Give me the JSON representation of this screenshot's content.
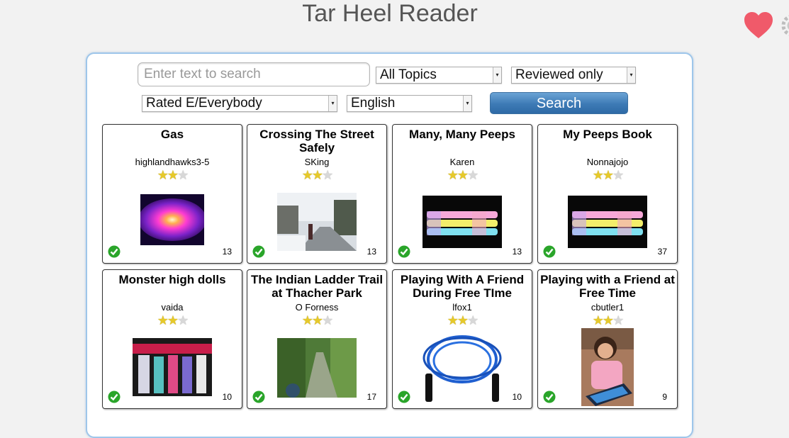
{
  "header": {
    "title": "Tar Heel Reader",
    "favorites_icon": "heart-icon",
    "settings_icon": "gear-icon"
  },
  "search": {
    "placeholder": "Enter text to search",
    "topic": "All Topics",
    "review": "Reviewed only",
    "rating": "Rated E/Everybody",
    "language": "English",
    "button_label": "Search"
  },
  "colors": {
    "heart": "#f05a6a",
    "button": "#3d7ab5",
    "check": "#2aa52a",
    "star": "#e6c92a"
  },
  "books": [
    {
      "title": "Gas",
      "author": "highlandhawks3-5",
      "rating": 2,
      "pages": "13",
      "reviewed": true
    },
    {
      "title": "Crossing The Street Safely",
      "author": "SKing",
      "rating": 2,
      "pages": "13",
      "reviewed": true
    },
    {
      "title": "Many, Many Peeps",
      "author": "Karen",
      "rating": 2,
      "pages": "13",
      "reviewed": true
    },
    {
      "title": "My Peeps Book",
      "author": "Nonnajojo",
      "rating": 2,
      "pages": "37",
      "reviewed": true
    },
    {
      "title": "Monster high dolls",
      "author": "vaida",
      "rating": 2,
      "pages": "10",
      "reviewed": true
    },
    {
      "title": "The Indian Ladder Trail at Thacher Park",
      "author": "O Forness",
      "rating": 2,
      "pages": "17",
      "reviewed": true
    },
    {
      "title": "Playing With A Friend During Free TIme",
      "author": "lfox1",
      "rating": 2,
      "pages": "10",
      "reviewed": true
    },
    {
      "title": "Playing with a Friend at Free Time",
      "author": "cbutler1",
      "rating": 2,
      "pages": "9",
      "reviewed": true
    }
  ]
}
